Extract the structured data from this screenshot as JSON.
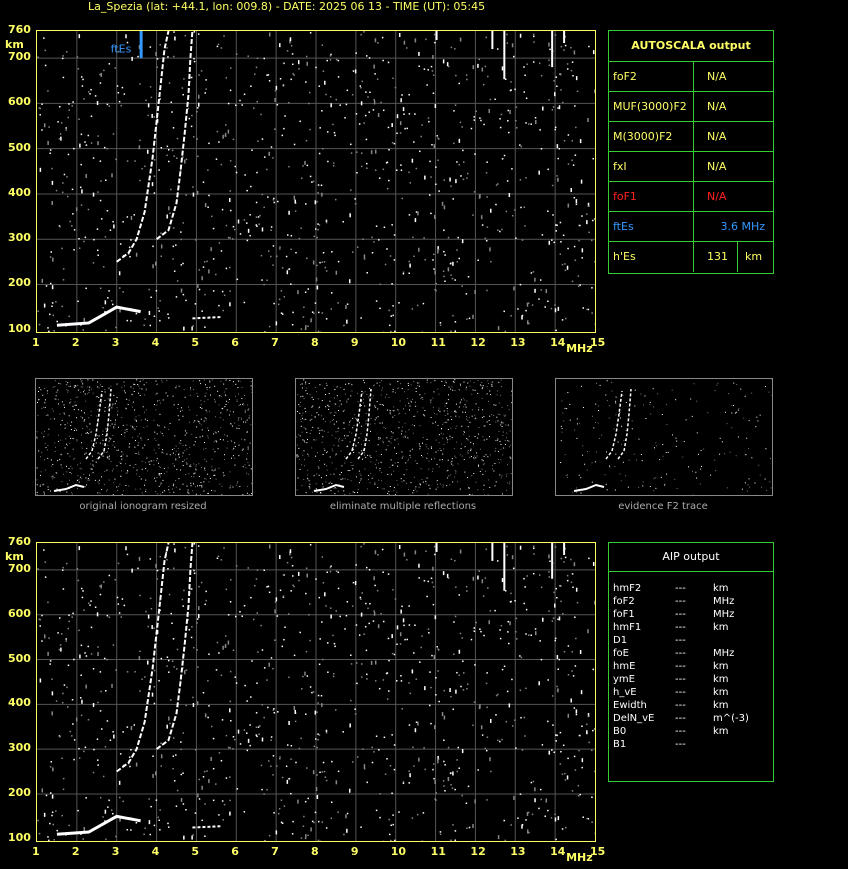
{
  "title": "La_Spezia (lat: +44.1, lon: 009.8) - DATE: 2025 06 13 - TIME (UT): 05:45",
  "axes": {
    "y_unit": "km",
    "x_unit": "MHz",
    "y_ticks": [
      "760",
      "700",
      "600",
      "500",
      "400",
      "300",
      "200",
      "100"
    ],
    "x_ticks": [
      "1",
      "2",
      "3",
      "4",
      "5",
      "6",
      "7",
      "8",
      "9",
      "10",
      "11",
      "12",
      "13",
      "14",
      "15"
    ]
  },
  "ftes_marker_label": "ftEs",
  "autoscala": {
    "header": "AUTOSCALA output",
    "rows": [
      {
        "param": "foF2",
        "value": "N/A",
        "unit": "",
        "color": "#ffff66"
      },
      {
        "param": "MUF(3000)F2",
        "value": "N/A",
        "unit": "",
        "color": "#ffff66"
      },
      {
        "param": "M(3000)F2",
        "value": "N/A",
        "unit": "",
        "color": "#ffff66"
      },
      {
        "param": "fxI",
        "value": "N/A",
        "unit": "",
        "color": "#ffff66"
      },
      {
        "param": "foF1",
        "value": "N/A",
        "unit": "",
        "color": "#ff2020"
      },
      {
        "param": "ftEs",
        "value": "3.6 MHz",
        "unit": "",
        "color": "#3399ff"
      },
      {
        "param": "h'Es",
        "value": "131",
        "unit": "km",
        "color": "#ffff66"
      }
    ]
  },
  "thumbnails": [
    {
      "caption": "original ionogram resized"
    },
    {
      "caption": "eliminate multiple reflections"
    },
    {
      "caption": "evidence F2 trace"
    }
  ],
  "aip": {
    "header": "AIP output",
    "rows": [
      {
        "param": "hmF2",
        "value": "---",
        "unit": "km"
      },
      {
        "param": "foF2",
        "value": "---",
        "unit": "MHz"
      },
      {
        "param": "foF1",
        "value": "---",
        "unit": "MHz"
      },
      {
        "param": "hmF1",
        "value": "---",
        "unit": "km"
      },
      {
        "param": "D1",
        "value": "---",
        "unit": ""
      },
      {
        "param": "foE",
        "value": "---",
        "unit": "MHz"
      },
      {
        "param": "hmE",
        "value": "---",
        "unit": "km"
      },
      {
        "param": "ymE",
        "value": "---",
        "unit": "km"
      },
      {
        "param": "h_vE",
        "value": "---",
        "unit": "km"
      },
      {
        "param": "Ewidth",
        "value": "---",
        "unit": "km"
      },
      {
        "param": "DelN_vE",
        "value": "---",
        "unit": "m^(-3)"
      },
      {
        "param": "B0",
        "value": "---",
        "unit": "km"
      },
      {
        "param": "B1",
        "value": "---",
        "unit": ""
      }
    ]
  },
  "colors": {
    "axis": "#ffff66",
    "grid": "#555555",
    "border": "#33cc33",
    "ftes": "#3399ff"
  }
}
